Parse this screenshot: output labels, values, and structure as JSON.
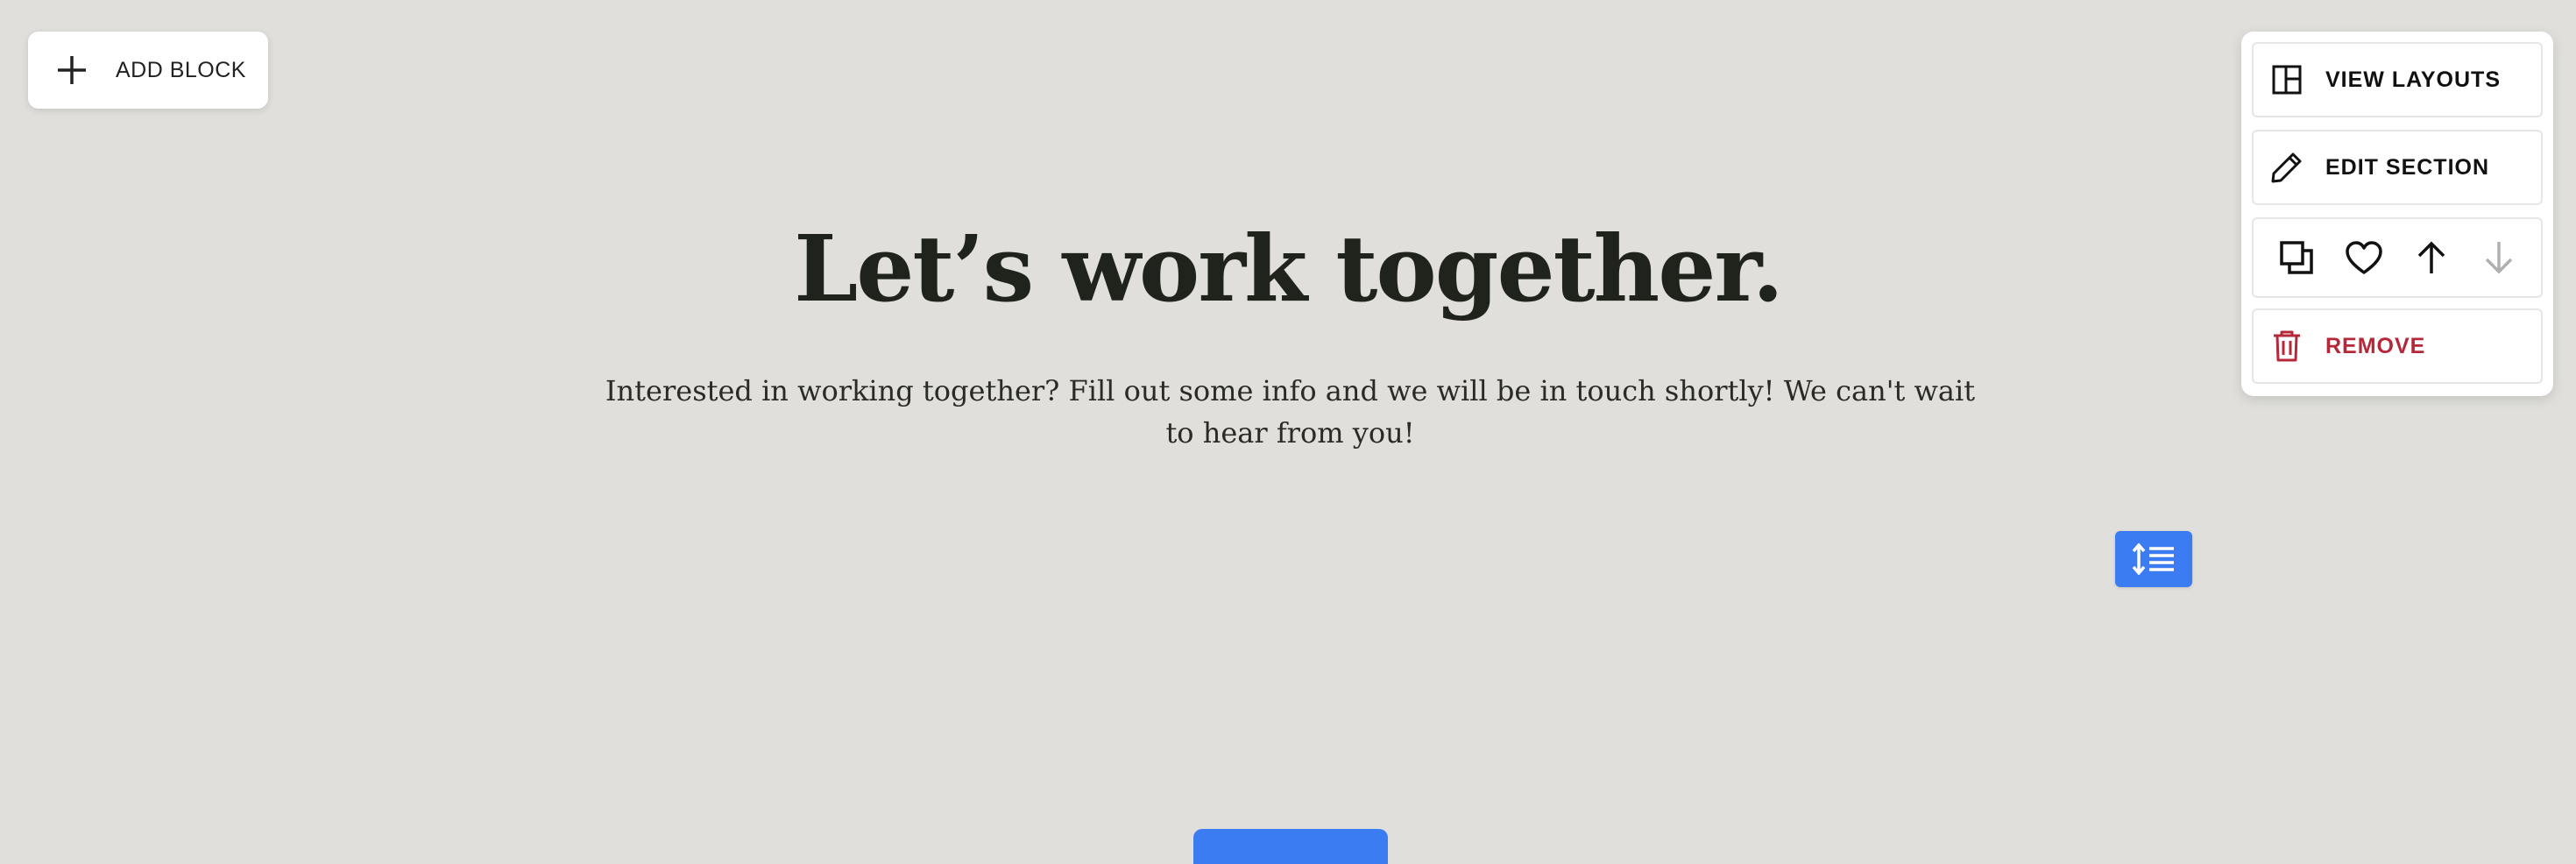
{
  "toolbar": {
    "add_block_label": "ADD BLOCK",
    "add_icon": "plus-icon"
  },
  "section": {
    "heading": "Let’s work together.",
    "description": "Interested in working together? Fill out some info and we will be in touch shortly! We can't wait to hear from you!"
  },
  "section_panel": {
    "view_layouts_label": "VIEW LAYOUTS",
    "edit_section_label": "EDIT SECTION",
    "remove_label": "REMOVE",
    "icons": [
      "layout-icon",
      "pencil-icon",
      "duplicate-icon",
      "heart-icon",
      "arrow-up-icon",
      "arrow-down-icon",
      "trash-icon"
    ]
  },
  "colors": {
    "background": "#e0dfdb",
    "heading": "#1f231c",
    "accent_blue": "#3b7cf3",
    "danger": "#b5283a",
    "disabled": "#b0b0b0"
  }
}
